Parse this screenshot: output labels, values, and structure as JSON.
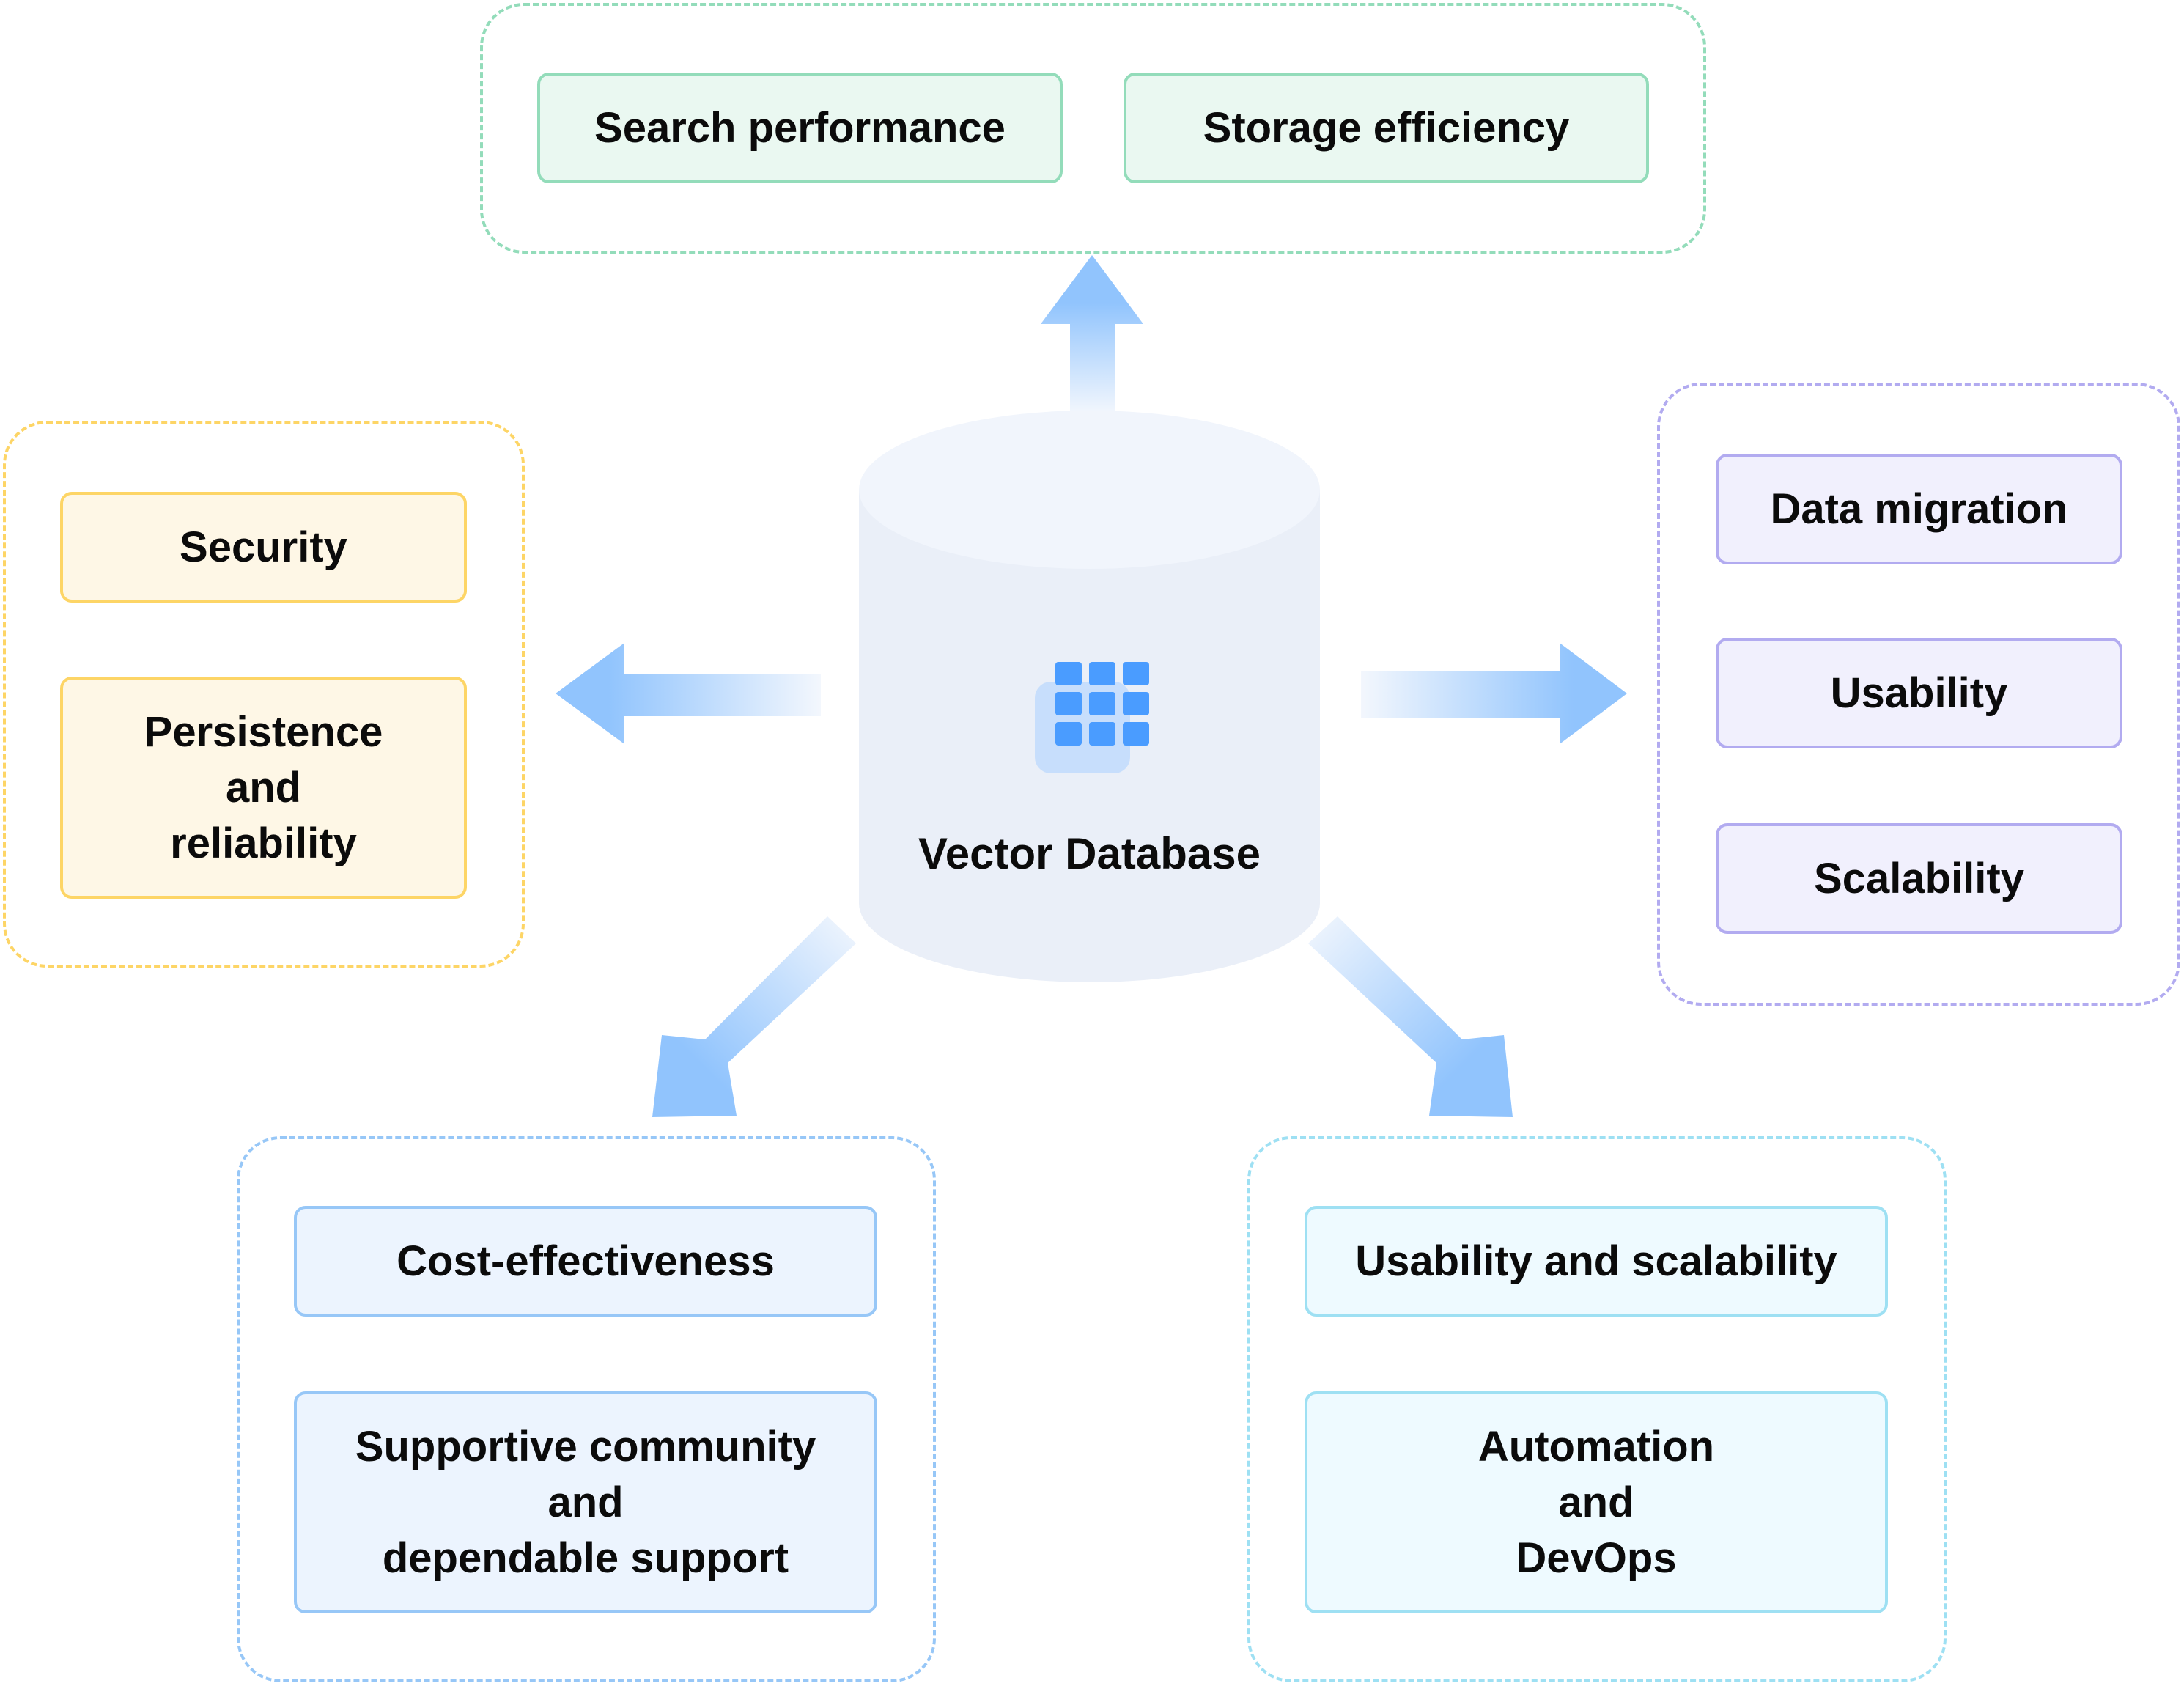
{
  "diagram": {
    "center": {
      "label": "Vector Database",
      "icon": "grid-database-icon"
    },
    "colors": {
      "arrow": "#91c4fd",
      "cylinder_body": "#eaeff8",
      "cylinder_top": "#f1f5fc",
      "icon_squares": "#4a9cff",
      "icon_backdrop": "#c7defc"
    },
    "groups": {
      "top": {
        "color": "#93dcba",
        "items": [
          "Search performance",
          "Storage efficiency"
        ]
      },
      "left": {
        "color": "#fdd566",
        "items": [
          "Security",
          "Persistence\nand\nreliability"
        ]
      },
      "right": {
        "color": "#b2abf0",
        "items": [
          "Data migration",
          "Usability",
          "Scalability"
        ]
      },
      "bottom_left": {
        "color": "#97c7f7",
        "items": [
          "Cost-effectiveness",
          "Supportive community\nand\ndependable support"
        ]
      },
      "bottom_right": {
        "color": "#9ee0f3",
        "items": [
          "Usability and scalability",
          "Automation\nand\nDevOps"
        ]
      }
    }
  }
}
